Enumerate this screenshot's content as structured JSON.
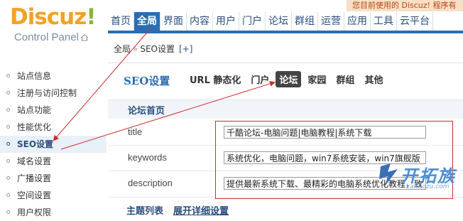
{
  "header": {
    "logo_main": "Discuz",
    "logo_excl": "!",
    "logo_sub": "Control Panel",
    "notice": "您目前使用的 Discuz! 程序有"
  },
  "nav": {
    "items": [
      "首页",
      "全局",
      "界面",
      "内容",
      "用户",
      "门户",
      "论坛",
      "群组",
      "运营",
      "应用",
      "工具",
      "云平台"
    ],
    "active_index": 1
  },
  "breadcrumb": {
    "root": "全局",
    "separator": "»",
    "current": "SEO设置",
    "plus": "[+]"
  },
  "sidebar": {
    "items": [
      "站点信息",
      "注册与访问控制",
      "站点功能",
      "性能优化",
      "SEO设置",
      "域名设置",
      "广播设置",
      "空间设置",
      "用户权限"
    ],
    "active_index": 4
  },
  "main": {
    "title": "SEO设置",
    "tabs": [
      "URL 静态化",
      "门户",
      "论坛",
      "家园",
      "群组",
      "其他"
    ],
    "active_tab_index": 2,
    "section_title": "论坛首页",
    "fields": {
      "title": {
        "label": "title",
        "value": "千酷论坛-电脑问题|电脑教程|系统下载"
      },
      "keywords": {
        "label": "keywords",
        "value": "系统优化，电脑问题，win7系统安装，win7旗舰版"
      },
      "description": {
        "label": "description",
        "value": "提供最新系统下载、最精彩的电脑系统优化教程，致"
      }
    },
    "footer_left": "主题列表",
    "footer_right": "展开详细设置"
  },
  "watermark": {
    "text": "开拓族",
    "url": "kaituozu.com"
  },
  "colors": {
    "accent": "#2b6db1",
    "annotation_red": "#d12b2b",
    "logo_orange": "#f0a227"
  }
}
